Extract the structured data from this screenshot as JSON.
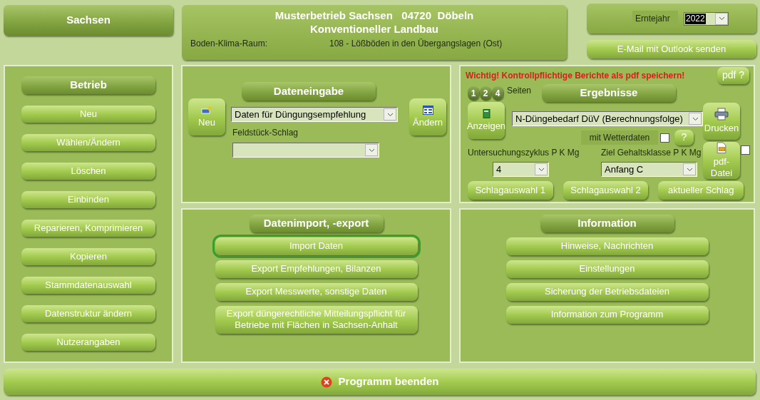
{
  "region_button": "Sachsen",
  "header": {
    "line1": "Musterbetrieb Sachsen   04720  Döbeln",
    "line2": "Konventioneller Landbau",
    "bkr_label": "Boden-Klima-Raum:",
    "bkr_value": "108 - Lößböden in den Übergangslagen (Ost)"
  },
  "year": {
    "label": "Erntejahr",
    "value": "2022"
  },
  "email_button": "E-Mail mit Outlook senden",
  "betrieb": {
    "title": "Betrieb",
    "buttons": [
      "Neu",
      "Wählen/Ändern",
      "Löschen",
      "Einbinden",
      "Reparieren, Komprimieren",
      "Kopieren",
      "Stammdatenauswahl",
      "Datenstruktur ändern",
      "Nutzerangaben"
    ]
  },
  "dateneingabe": {
    "title": "Dateneingabe",
    "new_button": "Neu",
    "edit_button": "Ändern",
    "type_select": "Daten für Düngungsempfehlung",
    "field_label": "Feldstück-Schlag"
  },
  "ergebnisse": {
    "warning": "Wichtig! Kontrollpflichtige Berichte als pdf speichern!",
    "pdf_help": "pdf ?",
    "pages": [
      "1",
      "2",
      "4"
    ],
    "pages_label": "Seiten",
    "title": "Ergebnisse",
    "show_button": "Anzeigen",
    "report_select": "N-Düngebedarf DüV (Berechnungsfolge)",
    "weather": {
      "label": "mit Wetterdaten",
      "checked": false
    },
    "help_button": "?",
    "print_button": "Drucken",
    "pdf_button": "pdf-Datei",
    "pdf_checkbox": {
      "checked": false
    },
    "cycle_label": "Untersuchungszyklus P K Mg",
    "cycle_value": "4",
    "target_label": "Ziel Gehaltsklasse P K Mg",
    "target_value": "Anfang C",
    "plot_buttons": [
      "Schlagauswahl 1",
      "Schlagauswahl 2",
      "aktueller Schlag"
    ]
  },
  "import_export": {
    "title": "Datenimport, -export",
    "buttons": [
      {
        "label": "Import Daten",
        "focused": true
      },
      {
        "label": "Export Empfehlungen, Bilanzen",
        "focused": false
      },
      {
        "label": "Export Messwerte, sonstige Daten",
        "focused": false
      },
      {
        "label": "Export düngerechtliche Mitteilungspflicht für Betriebe mit Flächen in Sachsen-Anhalt",
        "focused": false
      }
    ]
  },
  "information": {
    "title": "Information",
    "buttons": [
      "Hinweise, Nachrichten",
      "Einstellungen",
      "Sicherung der Betriebsdateien",
      "Information zum Programm"
    ]
  },
  "exit_button": "Programm beenden"
}
